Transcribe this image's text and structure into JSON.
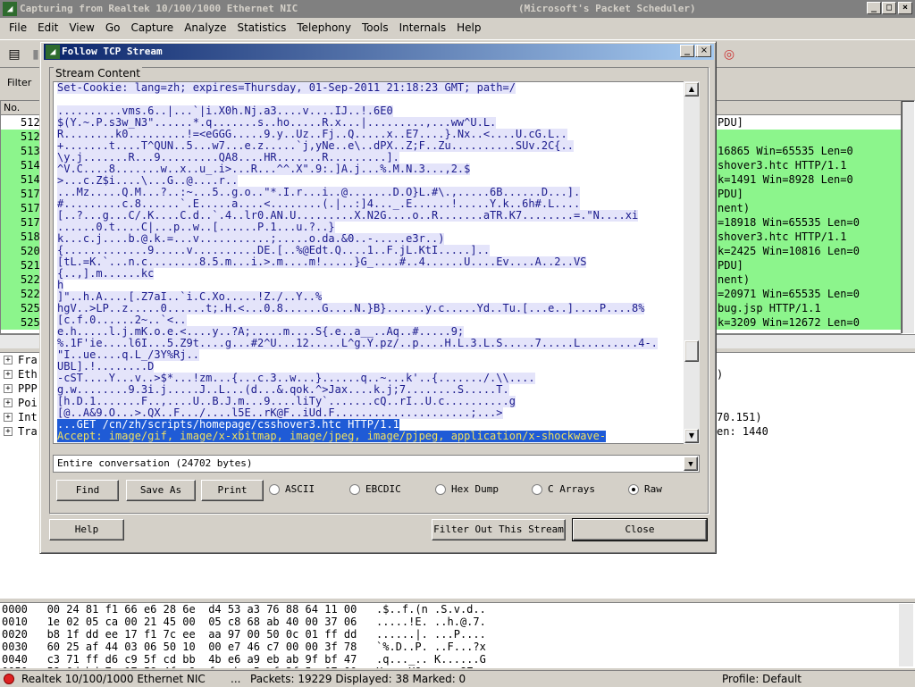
{
  "main_window": {
    "title": "Capturing from Realtek 10/100/1000 Ethernet NIC",
    "subtitle": "(Microsoft's Packet Scheduler)",
    "minimize": "_",
    "maximize": "□",
    "close": "×"
  },
  "menu": [
    "File",
    "Edit",
    "View",
    "Go",
    "Capture",
    "Analyze",
    "Statistics",
    "Telephony",
    "Tools",
    "Internals",
    "Help"
  ],
  "filter_label": "Filter",
  "packet_list": {
    "header_no": "No.",
    "rows": [
      {
        "no": "512",
        "info": "PDU]",
        "green": false
      },
      {
        "no": "512",
        "info": "",
        "green": true
      },
      {
        "no": "513",
        "info": "16865 Win=65535 Len=0",
        "green": true
      },
      {
        "no": "514",
        "info": "shover3.htc HTTP/1.1",
        "green": true
      },
      {
        "no": "514",
        "info": "k=1491 Win=8928 Len=0",
        "green": true
      },
      {
        "no": "517",
        "info": "PDU]",
        "green": true
      },
      {
        "no": "517",
        "info": "nent)",
        "green": true
      },
      {
        "no": "517",
        "info": "=18918 Win=65535 Len=0",
        "green": true
      },
      {
        "no": "518",
        "info": "shover3.htc HTTP/1.1",
        "green": true
      },
      {
        "no": "520",
        "info": "k=2425 Win=10816 Len=0",
        "green": true
      },
      {
        "no": "521",
        "info": "PDU]",
        "green": true
      },
      {
        "no": "522",
        "info": "nent)",
        "green": true
      },
      {
        "no": "522",
        "info": "=20971 Win=65535 Len=0",
        "green": true
      },
      {
        "no": "525",
        "info": "bug.jsp HTTP/1.1",
        "green": true
      },
      {
        "no": "525",
        "info": "k=3209 Win=12672 Len=0",
        "green": true
      }
    ]
  },
  "details": [
    {
      "label": "Fra",
      "right": ""
    },
    {
      "label": "Eth",
      "right": ")"
    },
    {
      "label": "PPP",
      "right": ""
    },
    {
      "label": "Poi",
      "right": ""
    },
    {
      "label": "Int",
      "right": "70.151)"
    },
    {
      "label": "Tra",
      "right": "en: 1440"
    }
  ],
  "hex_rows": [
    "0000   00 24 81 f1 66 e6 28 6e  d4 53 a3 76 88 64 11 00   .$..f.(n .S.v.d..",
    "0010   1e 02 05 ca 00 21 45 00  05 c8 68 ab 40 00 37 06   .....!E. ..h.@.7.",
    "0020   b8 1f dd ee 17 f1 7c ee  aa 97 00 50 0c 01 ff dd   ......|. ...P....",
    "0030   60 25 af 44 03 06 50 10  00 e7 46 c7 00 00 3f 78   `%.D..P. ..F...?x",
    "0040   c3 71 ff d6 c9 5f cd bb  4b e6 a9 eb ab 9f bf 47   .q..._.. K......G",
    "0050   58 0d bd 7a 17 58 4f e9  fa eb a5 cf 3f 5a 07 00   X..z.XO. ....?Z.."
  ],
  "status": {
    "interface": "Realtek 10/100/1000 Ethernet NIC",
    "sep": "...",
    "packets": "Packets: 19229 Displayed: 38 Marked: 0",
    "profile": "Profile: Default"
  },
  "dialog": {
    "title": "Follow TCP Stream",
    "group_label": "Stream Content",
    "stream_lines": [
      {
        "t": "Set-Cookie: lang=zh; expires=Thursday, 01-Sep-2011 21:18:23 GMT; path=/",
        "s": 0
      },
      {
        "t": "",
        "s": 0
      },
      {
        "t": "..........vms.6..|...`|i.X0h.Nj.a3....v....IJ..!.6E0",
        "s": 0
      },
      {
        "t": "$(Y.~.P.s3w_N3\"......*.q.......s..ho.....R.x...|.........,...ww^U.L.",
        "s": 0
      },
      {
        "t": "R........k0.........!=<eGGG.....9.y..Uz..Fj..Q.....x..E7....}.Nx..<....U.cG.L..",
        "s": 0
      },
      {
        "t": "+.......t....T^QUN..5...w7...e.z.....`j,yNe..e\\..dPX..Z;F..Zu..........SUv.2C{..",
        "s": 0
      },
      {
        "t": "\\y.j.......R...9.........QA8....HR.......R.........].",
        "s": 0
      },
      {
        "t": "^V.C....8.......w..x..u_.i>...R...^^.X\".9:.]A.j...%.M.N.3...,2.$",
        "s": 0
      },
      {
        "t": ">...c.Z$i....\\...G..@....r..",
        "s": 0
      },
      {
        "t": "...Mz.....Q.M...?..:~...5..g.o..\"*.I.r...i..@.......D.O}L.#\\.,.....6B......D...].",
        "s": 0
      },
      {
        "t": "#.........c.8......`.E.....a....<........(.|..:]4..._.E......!.....Y.k..6h#.L....",
        "s": 0
      },
      {
        "t": "[..?...g...C/.K....C.d..`.4..lr0.AN.U.........X.N2G....o..R.......aTR.K7........=.\"N....xi",
        "s": 0
      },
      {
        "t": "......0.t....C|...p..w..[......P.1...u.?..}",
        "s": 0
      },
      {
        "t": "k...c.j....b.@.k.=...v...........;.....o.da.&0..-.....e3r..)",
        "s": 0
      },
      {
        "t": "{.............9.....v..........DE.[..%@Edt.Q....1..F.jL.KtI.....]..",
        "s": 0
      },
      {
        "t": "[tL.=K.`...n.c........8.5.m...i.>.m....m!.....}G_....#..4......U....Ev....A..2..VS",
        "s": 0
      },
      {
        "t": "{..,].m......kc",
        "s": 0
      },
      {
        "t": "h",
        "s": 0
      },
      {
        "t": "]\"..h.A....[.Z7aI..`i.C.Xo.....!Z./..Y..%",
        "s": 0
      },
      {
        "t": "hgV..>LP..z.....0......t;.H.<...0.8......G....N.}B}......y.c.....Yd..Tu.[...e..]....P....8%",
        "s": 0
      },
      {
        "t": "[c.f.0......2~..`<..",
        "s": 0
      },
      {
        "t": "e.h.....l.j.mK.o.e.<....y..?A;.....m....S{.e..a__..Aq..#.....9;",
        "s": 0
      },
      {
        "t": "%.1F'ie....l6I...5.Z9t....g...#2^U...12.....L^g.Y.pz/..p....H.L.3.L.S.....7.....L.........4-.",
        "s": 0
      },
      {
        "t": "\"I..ue....q.L_/3Y%Rj..",
        "s": 0
      },
      {
        "t": "UBL].!........D",
        "s": 0
      },
      {
        "t": "-cST....Y...v..>$*...!zm...{...c.3..w...}......q..~...k'..{......./.\\\\....",
        "s": 0
      },
      {
        "t": "g.w........9.3i.j.....J..L...(d...&.qok.^>Jax....k.j;7........S.....T.",
        "s": 0
      },
      {
        "t": "[h.D.1.......F..,....U..B.J.m...9....liTy`.......cQ..rI..U.c..........g",
        "s": 0
      },
      {
        "t": "[@..A&9.O...>.QX..F.../....l5E..rK@F..iUd.F.....................;...>",
        "s": 0
      },
      {
        "t": "...GET /cn/zh/scripts/homepage/csshover3.htc HTTP/1.1",
        "s": 1
      },
      {
        "t": "Accept: image/gif, image/x-xbitmap, image/jpeg, image/pjpeg, application/x-shockwave-",
        "s": 2
      }
    ],
    "dropdown_value": "Entire conversation (24702 bytes)",
    "buttons": {
      "find": "Find",
      "save_as": "Save As",
      "print": "Print",
      "help": "Help",
      "filter_out": "Filter Out This Stream",
      "close": "Close"
    },
    "radios": [
      {
        "label": "ASCII",
        "checked": false
      },
      {
        "label": "EBCDIC",
        "checked": false
      },
      {
        "label": "Hex Dump",
        "checked": false
      },
      {
        "label": "C Arrays",
        "checked": false
      },
      {
        "label": "Raw",
        "checked": true
      }
    ]
  }
}
